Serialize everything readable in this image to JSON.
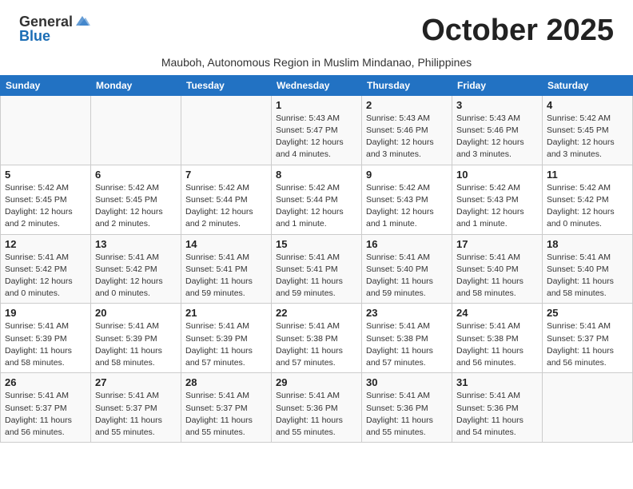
{
  "header": {
    "logo_general": "General",
    "logo_blue": "Blue",
    "month_title": "October 2025",
    "subtitle": "Mauboh, Autonomous Region in Muslim Mindanao, Philippines"
  },
  "weekdays": [
    "Sunday",
    "Monday",
    "Tuesday",
    "Wednesday",
    "Thursday",
    "Friday",
    "Saturday"
  ],
  "weeks": [
    [
      {
        "day": "",
        "detail": ""
      },
      {
        "day": "",
        "detail": ""
      },
      {
        "day": "",
        "detail": ""
      },
      {
        "day": "1",
        "detail": "Sunrise: 5:43 AM\nSunset: 5:47 PM\nDaylight: 12 hours\nand 4 minutes."
      },
      {
        "day": "2",
        "detail": "Sunrise: 5:43 AM\nSunset: 5:46 PM\nDaylight: 12 hours\nand 3 minutes."
      },
      {
        "day": "3",
        "detail": "Sunrise: 5:43 AM\nSunset: 5:46 PM\nDaylight: 12 hours\nand 3 minutes."
      },
      {
        "day": "4",
        "detail": "Sunrise: 5:42 AM\nSunset: 5:45 PM\nDaylight: 12 hours\nand 3 minutes."
      }
    ],
    [
      {
        "day": "5",
        "detail": "Sunrise: 5:42 AM\nSunset: 5:45 PM\nDaylight: 12 hours\nand 2 minutes."
      },
      {
        "day": "6",
        "detail": "Sunrise: 5:42 AM\nSunset: 5:45 PM\nDaylight: 12 hours\nand 2 minutes."
      },
      {
        "day": "7",
        "detail": "Sunrise: 5:42 AM\nSunset: 5:44 PM\nDaylight: 12 hours\nand 2 minutes."
      },
      {
        "day": "8",
        "detail": "Sunrise: 5:42 AM\nSunset: 5:44 PM\nDaylight: 12 hours\nand 1 minute."
      },
      {
        "day": "9",
        "detail": "Sunrise: 5:42 AM\nSunset: 5:43 PM\nDaylight: 12 hours\nand 1 minute."
      },
      {
        "day": "10",
        "detail": "Sunrise: 5:42 AM\nSunset: 5:43 PM\nDaylight: 12 hours\nand 1 minute."
      },
      {
        "day": "11",
        "detail": "Sunrise: 5:42 AM\nSunset: 5:42 PM\nDaylight: 12 hours\nand 0 minutes."
      }
    ],
    [
      {
        "day": "12",
        "detail": "Sunrise: 5:41 AM\nSunset: 5:42 PM\nDaylight: 12 hours\nand 0 minutes."
      },
      {
        "day": "13",
        "detail": "Sunrise: 5:41 AM\nSunset: 5:42 PM\nDaylight: 12 hours\nand 0 minutes."
      },
      {
        "day": "14",
        "detail": "Sunrise: 5:41 AM\nSunset: 5:41 PM\nDaylight: 11 hours\nand 59 minutes."
      },
      {
        "day": "15",
        "detail": "Sunrise: 5:41 AM\nSunset: 5:41 PM\nDaylight: 11 hours\nand 59 minutes."
      },
      {
        "day": "16",
        "detail": "Sunrise: 5:41 AM\nSunset: 5:40 PM\nDaylight: 11 hours\nand 59 minutes."
      },
      {
        "day": "17",
        "detail": "Sunrise: 5:41 AM\nSunset: 5:40 PM\nDaylight: 11 hours\nand 58 minutes."
      },
      {
        "day": "18",
        "detail": "Sunrise: 5:41 AM\nSunset: 5:40 PM\nDaylight: 11 hours\nand 58 minutes."
      }
    ],
    [
      {
        "day": "19",
        "detail": "Sunrise: 5:41 AM\nSunset: 5:39 PM\nDaylight: 11 hours\nand 58 minutes."
      },
      {
        "day": "20",
        "detail": "Sunrise: 5:41 AM\nSunset: 5:39 PM\nDaylight: 11 hours\nand 58 minutes."
      },
      {
        "day": "21",
        "detail": "Sunrise: 5:41 AM\nSunset: 5:39 PM\nDaylight: 11 hours\nand 57 minutes."
      },
      {
        "day": "22",
        "detail": "Sunrise: 5:41 AM\nSunset: 5:38 PM\nDaylight: 11 hours\nand 57 minutes."
      },
      {
        "day": "23",
        "detail": "Sunrise: 5:41 AM\nSunset: 5:38 PM\nDaylight: 11 hours\nand 57 minutes."
      },
      {
        "day": "24",
        "detail": "Sunrise: 5:41 AM\nSunset: 5:38 PM\nDaylight: 11 hours\nand 56 minutes."
      },
      {
        "day": "25",
        "detail": "Sunrise: 5:41 AM\nSunset: 5:37 PM\nDaylight: 11 hours\nand 56 minutes."
      }
    ],
    [
      {
        "day": "26",
        "detail": "Sunrise: 5:41 AM\nSunset: 5:37 PM\nDaylight: 11 hours\nand 56 minutes."
      },
      {
        "day": "27",
        "detail": "Sunrise: 5:41 AM\nSunset: 5:37 PM\nDaylight: 11 hours\nand 55 minutes."
      },
      {
        "day": "28",
        "detail": "Sunrise: 5:41 AM\nSunset: 5:37 PM\nDaylight: 11 hours\nand 55 minutes."
      },
      {
        "day": "29",
        "detail": "Sunrise: 5:41 AM\nSunset: 5:36 PM\nDaylight: 11 hours\nand 55 minutes."
      },
      {
        "day": "30",
        "detail": "Sunrise: 5:41 AM\nSunset: 5:36 PM\nDaylight: 11 hours\nand 55 minutes."
      },
      {
        "day": "31",
        "detail": "Sunrise: 5:41 AM\nSunset: 5:36 PM\nDaylight: 11 hours\nand 54 minutes."
      },
      {
        "day": "",
        "detail": ""
      }
    ]
  ]
}
